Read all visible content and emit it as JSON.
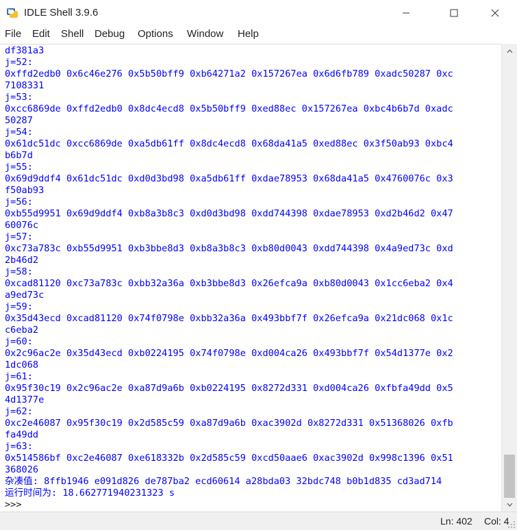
{
  "window": {
    "title": "IDLE Shell 3.9.6",
    "icons": [
      "python-icon",
      "minimize-icon",
      "maximize-icon",
      "close-icon"
    ]
  },
  "menu": [
    "File",
    "Edit",
    "Shell",
    "Debug",
    "Options",
    "Window",
    "Help"
  ],
  "output_lines": [
    "df381a3",
    "j=52:",
    "0xffd2edb0 0x6c46e276 0x5b50bff9 0xb64271a2 0x157267ea 0x6d6fb789 0xadc50287 0xc",
    "7108331",
    "j=53:",
    "0xcc6869de 0xffd2edb0 0x8dc4ecd8 0x5b50bff9 0xed88ec 0x157267ea 0xbc4b6b7d 0xadc",
    "50287",
    "j=54:",
    "0x61dc51dc 0xcc6869de 0xa5db61ff 0x8dc4ecd8 0x68da41a5 0xed88ec 0x3f50ab93 0xbc4",
    "b6b7d",
    "j=55:",
    "0x69d9ddf4 0x61dc51dc 0xd0d3bd98 0xa5db61ff 0xdae78953 0x68da41a5 0x4760076c 0x3",
    "f50ab93",
    "j=56:",
    "0xb55d9951 0x69d9ddf4 0xb8a3b8c3 0xd0d3bd98 0xdd744398 0xdae78953 0xd2b46d2 0x47",
    "60076c",
    "j=57:",
    "0xc73a783c 0xb55d9951 0xb3bbe8d3 0xb8a3b8c3 0xb80d0043 0xdd744398 0x4a9ed73c 0xd",
    "2b46d2",
    "j=58:",
    "0xcad81120 0xc73a783c 0xbb32a36a 0xb3bbe8d3 0x26efca9a 0xb80d0043 0x1cc6eba2 0x4",
    "a9ed73c",
    "j=59:",
    "0x35d43ecd 0xcad81120 0x74f0798e 0xbb32a36a 0x493bbf7f 0x26efca9a 0x21dc068 0x1c",
    "c6eba2",
    "j=60:",
    "0x2c96ac2e 0x35d43ecd 0xb0224195 0x74f0798e 0xd004ca26 0x493bbf7f 0x54d1377e 0x2",
    "1dc068",
    "j=61:",
    "0x95f30c19 0x2c96ac2e 0xa87d9a6b 0xb0224195 0x8272d331 0xd004ca26 0xfbfa49dd 0x5",
    "4d1377e",
    "j=62:",
    "0xc2e46087 0x95f30c19 0x2d585c59 0xa87d9a6b 0xac3902d 0x8272d331 0x51368026 0xfb",
    "fa49dd",
    "j=63:",
    "0x514586bf 0xc2e46087 0xe618332b 0x2d585c59 0xcd50aae6 0xac3902d 0x998c1396 0x51",
    "368026",
    "杂凑值: 8ffb1946 e091d826 de787ba2 ecd60614 a28bda03 32bdc748 b0b1d835 cd3ad714",
    "运行时间为: 18.662771940231323 s"
  ],
  "prompt": ">>>",
  "status": {
    "line": "Ln: 402",
    "col": "Col: 4"
  },
  "colors": {
    "output": "#0000ff",
    "prompt": "#1c1c1c",
    "scrollbar_thumb": "#c2c2c2"
  }
}
